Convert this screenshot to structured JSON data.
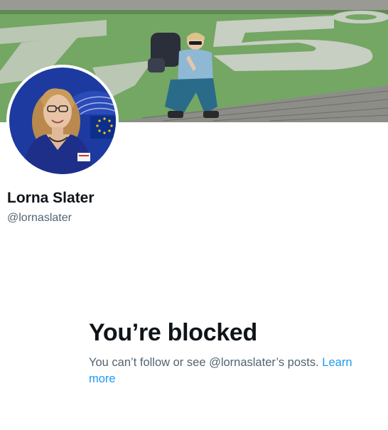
{
  "profile": {
    "display_name": "Lorna Slater",
    "handle": "@lornaslater"
  },
  "blocked": {
    "title": "You’re blocked",
    "message": "You can’t follow or see @lornaslater’s posts.",
    "link_label": "Learn more"
  },
  "colors": {
    "text_primary": "#0f1419",
    "text_secondary": "#536471",
    "link": "#1d9bf0",
    "banner_green": "#6b9a5a"
  }
}
